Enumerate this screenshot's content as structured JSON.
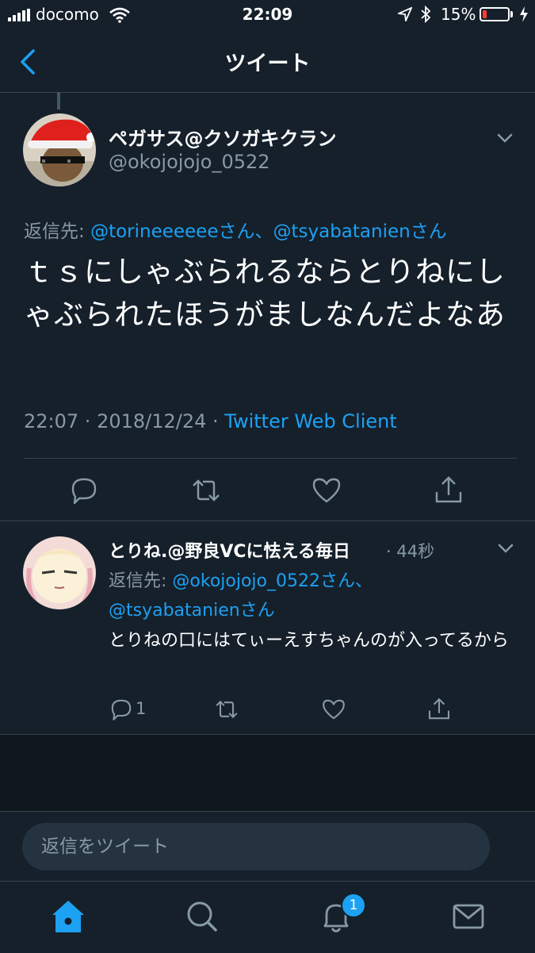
{
  "status_bar": {
    "carrier": "docomo",
    "time": "22:09",
    "battery_percent": "15%",
    "battery_level": 0.15
  },
  "nav": {
    "title": "ツイート",
    "back_icon": "chevron-left-icon"
  },
  "main_tweet": {
    "display_name": "ペガサス@クソガキクラン",
    "handle": "@okojojojo_0522",
    "reply_prefix": "返信先: ",
    "reply_to_1": "@torineeeeeeさん、",
    "reply_to_2": "@tsyabatanienさん",
    "text": "ｔｓにしゃぶられるならとりねにしゃぶられたほうがましなんだよなあ",
    "time": "22:07",
    "date": "2018/12/24",
    "meta_sep": " · ",
    "client": "Twitter Web Client"
  },
  "reply_tweet": {
    "display_name": "とりね.@野良VCに怯える毎日",
    "time_ago": "· 44秒",
    "reply_prefix": "返信先: ",
    "reply_to_1": "@okojojojo_0522さん、",
    "reply_to_2": "@tsyabatanienさん",
    "text": "とりねの口にはてぃーえすちゃんのが入ってるから",
    "reply_count": "1"
  },
  "compose": {
    "placeholder": "返信をツイート"
  },
  "tab_bar": {
    "notification_count": "1"
  },
  "colors": {
    "background": "#15202b",
    "accent": "#1da1f2",
    "muted": "#8899a6",
    "battery_low": "#ff3b30"
  }
}
